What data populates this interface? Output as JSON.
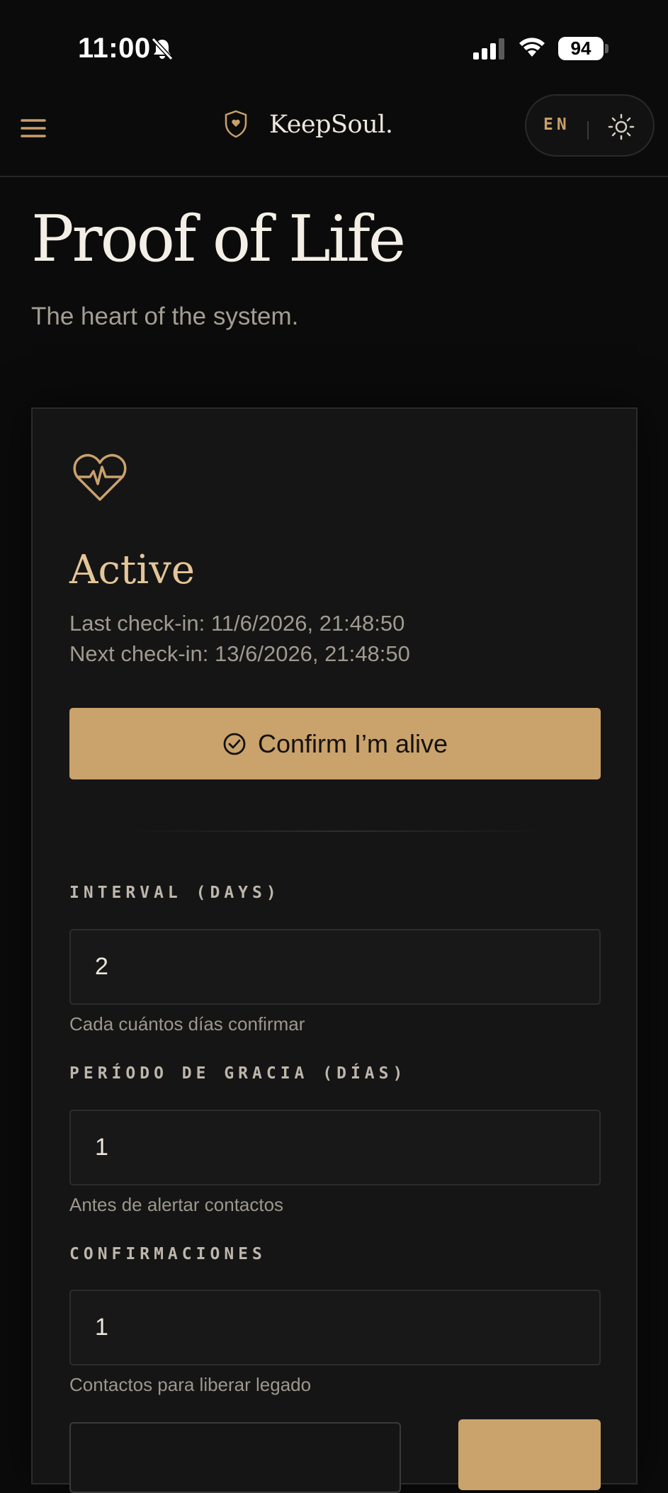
{
  "status_bar": {
    "time": "11:00",
    "battery": "94"
  },
  "navbar": {
    "brand": "KeepSoul.",
    "language": "EN"
  },
  "page": {
    "title": "Proof of Life",
    "subtitle": "The heart of the system."
  },
  "status_card": {
    "status": "Active",
    "last_checkin": "Last check-in: 11/6/2026, 21:48:50",
    "next_checkin": "Next check-in: 13/6/2026, 21:48:50",
    "confirm_label": "Confirm I’m alive"
  },
  "settings": {
    "interval": {
      "label": "INTERVAL (DAYS)",
      "value": "2",
      "hint": "Cada cuántos días confirmar"
    },
    "grace": {
      "label": "PERÍODO DE GRACIA (DÍAS)",
      "value": "1",
      "hint": "Antes de alertar contactos"
    },
    "confirmations": {
      "label": "CONFIRMACIONES",
      "value": "1",
      "hint": "Contactos para liberar legado"
    }
  },
  "colors": {
    "background": "#0b0b0b",
    "accent": "#caa26c",
    "status_text": "#e3c597"
  },
  "icons": [
    "bell-slash-icon",
    "signal-icon",
    "wifi-icon",
    "menu-icon",
    "shield-heart-icon",
    "sun-icon",
    "heart-pulse-icon",
    "check-circle-icon"
  ]
}
